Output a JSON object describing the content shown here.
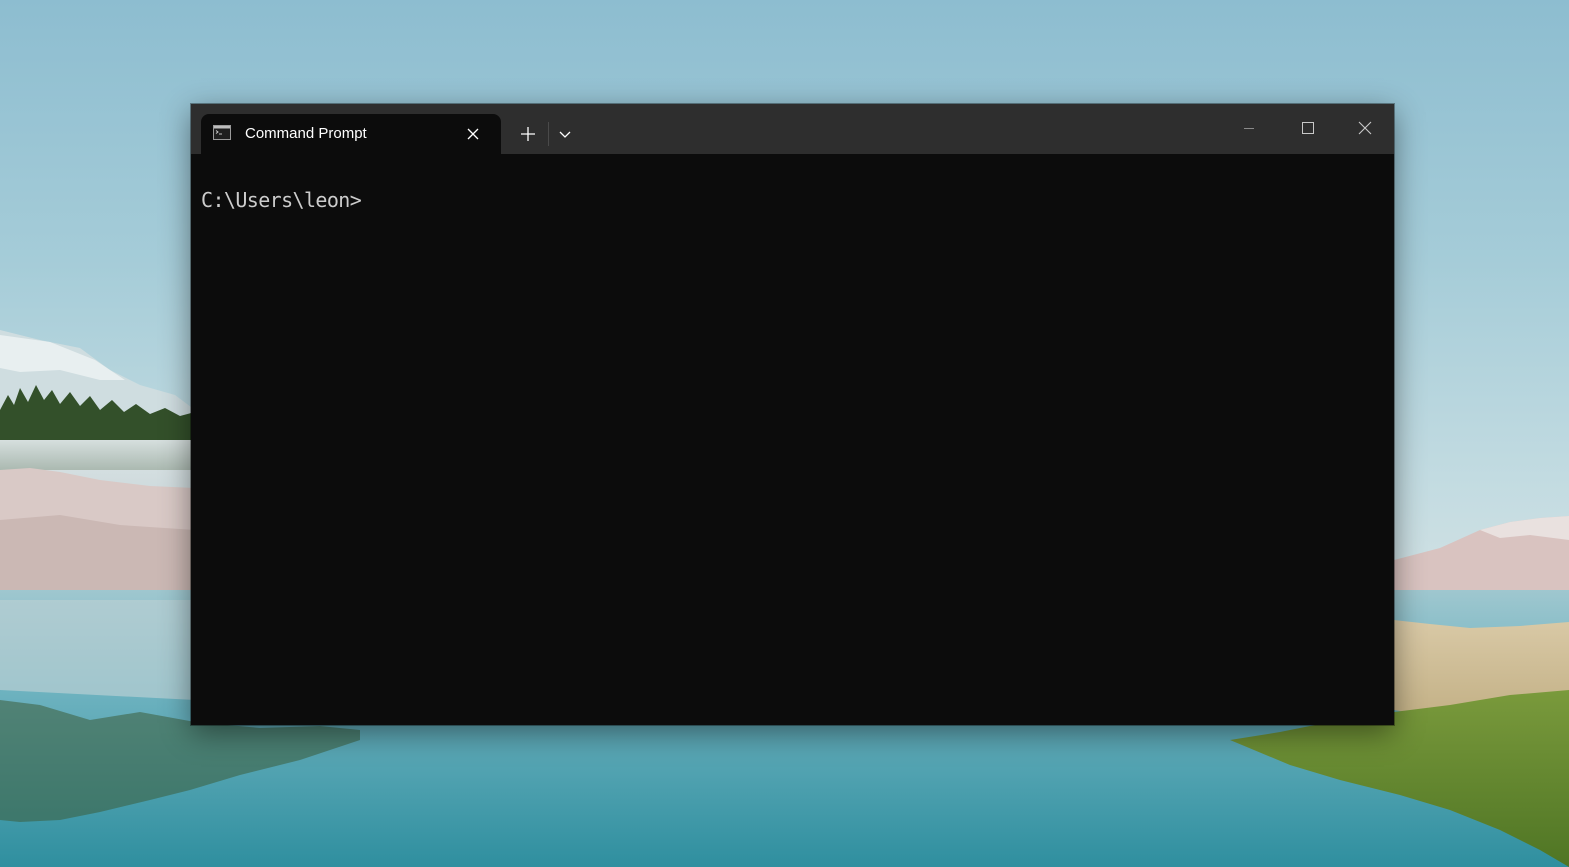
{
  "desktop": {
    "wallpaper": "lake-landscape"
  },
  "window": {
    "tabs": [
      {
        "title": "Command Prompt",
        "icon": "command-prompt-icon",
        "active": true
      }
    ],
    "controls": {
      "new_tab_icon": "plus-icon",
      "dropdown_icon": "chevron-down-icon",
      "minimize_icon": "minimize-icon",
      "maximize_icon": "maximize-icon",
      "close_icon": "close-icon"
    },
    "console": {
      "prompt": "C:\\Users\\leon>"
    }
  },
  "colors": {
    "console_background": "#0c0c0c",
    "titlebar_background": "#2e2e2e",
    "console_text": "#cccccc",
    "tab_text": "#ffffff"
  }
}
